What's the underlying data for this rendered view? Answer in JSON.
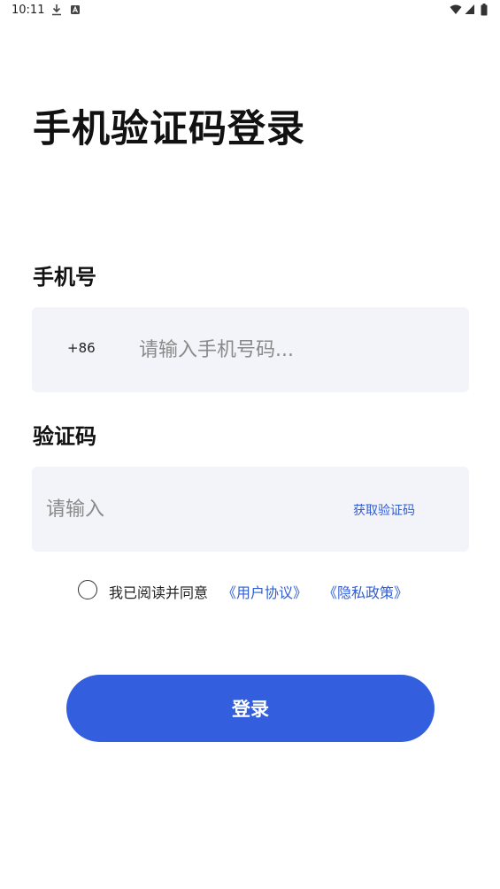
{
  "status_bar": {
    "time": "10:11",
    "icons": [
      "download-icon",
      "a-icon",
      "wifi-icon",
      "signal-icon",
      "battery-icon"
    ]
  },
  "page": {
    "title": "手机验证码登录"
  },
  "phone": {
    "label": "手机号",
    "country_code": "+86",
    "placeholder": "请输入手机号码...",
    "value": ""
  },
  "code": {
    "label": "验证码",
    "placeholder": "请输入",
    "value": "",
    "get_code_label": "获取验证码"
  },
  "agreement": {
    "checked": false,
    "text": "我已阅读并同意",
    "user_agreement": "《用户协议》",
    "privacy_policy": "《隐私政策》"
  },
  "login": {
    "label": "登录"
  },
  "colors": {
    "accent": "#335fdf",
    "link": "#2f5ed6",
    "field_bg": "#f3f4f9"
  }
}
